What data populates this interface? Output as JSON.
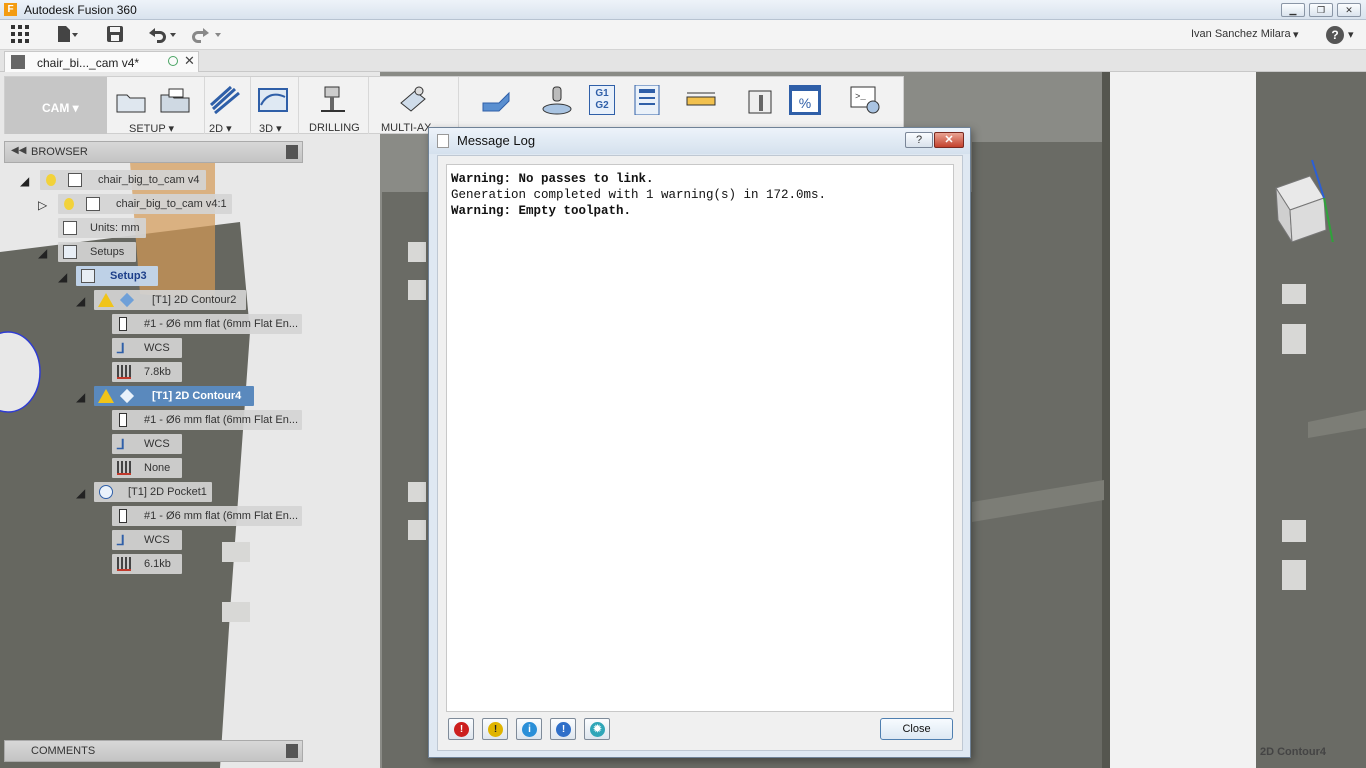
{
  "window": {
    "title": "Autodesk Fusion 360",
    "minimize": "▁",
    "restore": "❐",
    "close": "✕"
  },
  "quick_access": {
    "user_name": "Ivan Sanchez Milara",
    "user_caret": "▾",
    "help": "?",
    "help_caret": "▾"
  },
  "doc_tab": {
    "name": "chair_bi..._cam v4*",
    "close": "✕"
  },
  "toolbar": {
    "workspace": "CAM ▾",
    "groups": [
      {
        "label": "SETUP ▾"
      },
      {
        "label": "2D ▾"
      },
      {
        "label": "3D ▾"
      },
      {
        "label": "DRILLING"
      },
      {
        "label": "MULTI-AX"
      }
    ]
  },
  "browser": {
    "header": "BROWSER",
    "items": [
      {
        "label": "chair_big_to_cam v4"
      },
      {
        "label": "chair_big_to_cam v4:1"
      },
      {
        "label": "Units: mm"
      },
      {
        "label": "Setups"
      },
      {
        "label": "Setup3"
      },
      {
        "label": "[T1] 2D Contour2"
      },
      {
        "label": "#1 - Ø6 mm flat (6mm Flat En..."
      },
      {
        "label": "WCS"
      },
      {
        "label": "7.8kb"
      },
      {
        "label": "[T1] 2D Contour4"
      },
      {
        "label": "#1 - Ø6 mm flat (6mm Flat En..."
      },
      {
        "label": "WCS"
      },
      {
        "label": "None"
      },
      {
        "label": "[T1] 2D Pocket1"
      },
      {
        "label": "#1 - Ø6 mm flat (6mm Flat En..."
      },
      {
        "label": "WCS"
      },
      {
        "label": "6.1kb"
      }
    ]
  },
  "comments": {
    "header": "COMMENTS"
  },
  "message_log": {
    "title": "Message Log",
    "help_btn": "?",
    "close_x": "✕",
    "lines": [
      {
        "text": "Warning: No passes to link.",
        "kind": "warning"
      },
      {
        "text": "Generation completed with 1 warning(s) in 172.0ms.",
        "kind": "info"
      },
      {
        "text": "Warning: Empty toolpath.",
        "kind": "warning"
      }
    ],
    "filters": [
      {
        "glyph": "!",
        "color": "#cc1f1f"
      },
      {
        "glyph": "!",
        "color": "#e0b400"
      },
      {
        "glyph": "i",
        "color": "#2a8fd8"
      },
      {
        "glyph": "!",
        "color": "#2f6fc9"
      },
      {
        "glyph": "✹",
        "color": "#2fa6b8"
      }
    ],
    "close_label": "Close"
  },
  "viewport": {
    "status": "2D Contour4"
  }
}
